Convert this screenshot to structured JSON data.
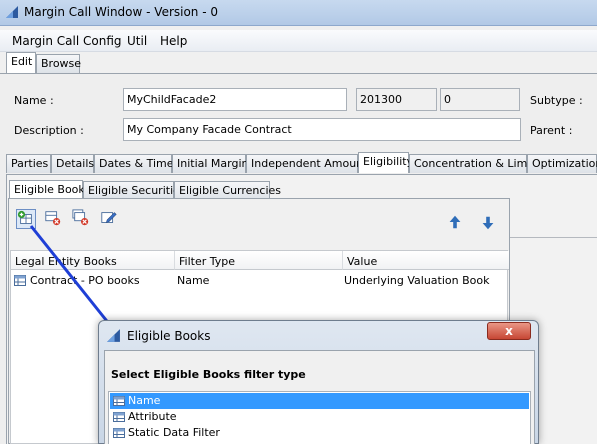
{
  "window": {
    "title": "Margin Call Window - Version - 0"
  },
  "menu": [
    "Margin Call Config",
    "Util",
    "Help"
  ],
  "top_tabs": [
    {
      "label": "Edit",
      "active": true
    },
    {
      "label": "Browse",
      "active": false
    }
  ],
  "form": {
    "name_label": "Name :",
    "name_value": "MyChildFacade2",
    "id_value": "201300",
    "version_value": "0",
    "subtype_label": "Subtype :",
    "description_label": "Description :",
    "description_value": "My Company Facade Contract",
    "parent_label": "Parent :"
  },
  "section_tabs": [
    {
      "label": "Parties",
      "active": false
    },
    {
      "label": "Details",
      "active": false
    },
    {
      "label": "Dates & Times",
      "active": false
    },
    {
      "label": "Initial Margin",
      "active": false
    },
    {
      "label": "Independent Amount",
      "active": false
    },
    {
      "label": "Eligibility",
      "active": true
    },
    {
      "label": "Concentration & Limits",
      "active": false
    },
    {
      "label": "Optimization",
      "active": false
    }
  ],
  "eligibility_tabs": [
    {
      "label": "Eligible Books",
      "active": true
    },
    {
      "label": "Eligible Securities",
      "active": false
    },
    {
      "label": "Eligible Currencies",
      "active": false
    }
  ],
  "toolbar_icons": [
    "add-grid-icon",
    "delete-grid-icon",
    "delete-all-grid-icon",
    "edit-icon",
    "move-up-icon",
    "move-down-icon"
  ],
  "table": {
    "columns": [
      "Legal Entity Books",
      "Filter Type",
      "Value"
    ],
    "rows": [
      {
        "books": "Contract - PO books",
        "filter_type": "Name",
        "value": "Underlying Valuation Book"
      }
    ]
  },
  "dialog": {
    "title": "Eligible Books",
    "close_label": "x",
    "heading": "Select Eligible Books filter type",
    "options": [
      {
        "label": "Name",
        "selected": true
      },
      {
        "label": "Attribute",
        "selected": false
      },
      {
        "label": "Static Data Filter",
        "selected": false
      }
    ]
  },
  "colors": {
    "selection": "#3399ff",
    "arrow": "#1f3fd6",
    "title_bar": "#b2c9e6"
  }
}
